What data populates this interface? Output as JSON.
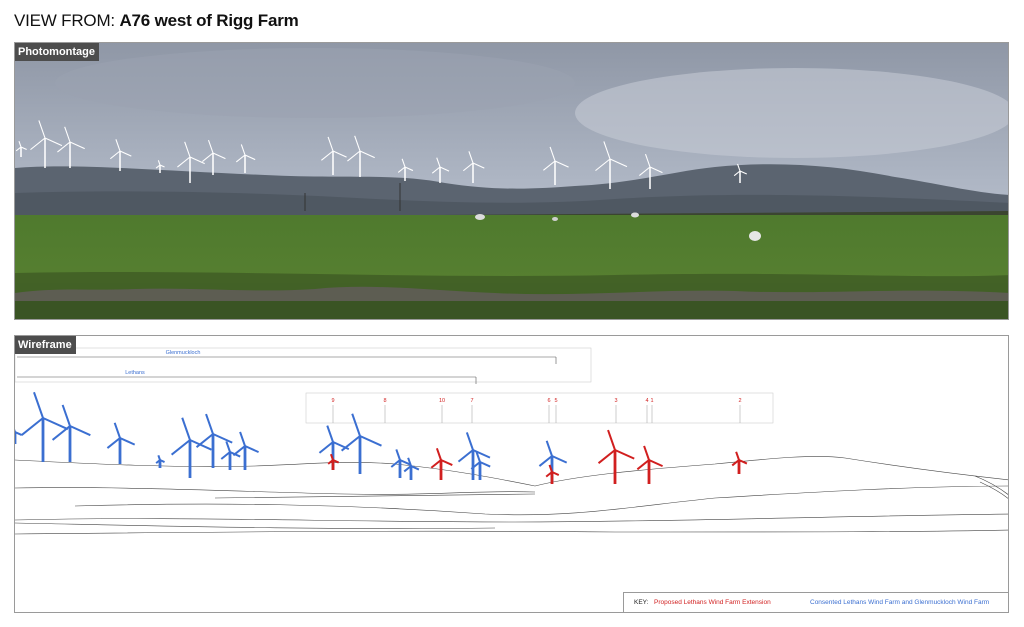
{
  "header": {
    "prefix": "VIEW FROM: ",
    "location": "A76 west of Rigg Farm"
  },
  "photomontage": {
    "label": "Photomontage"
  },
  "wireframe": {
    "label": "Wireframe",
    "extent_bars": [
      {
        "name": "Glenmuckloch"
      },
      {
        "name": "Lethans"
      }
    ],
    "proposed_turbine_numbers": [
      "9",
      "8",
      "10",
      "7",
      "6",
      "5",
      "3",
      "4",
      "1",
      "2"
    ],
    "colors": {
      "proposed": "#d11f1f",
      "consented": "#3b6fd1"
    }
  },
  "key": {
    "label": "KEY:",
    "proposed": "Proposed Lethans Wind Farm Extension",
    "consented": "Consented Lethans Wind Farm and Glenmuckloch Wind Farm"
  }
}
